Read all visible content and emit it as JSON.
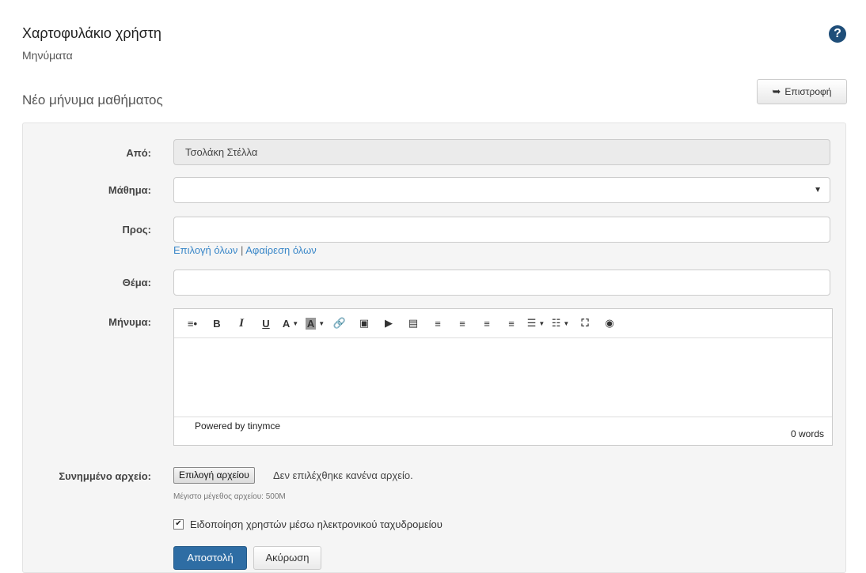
{
  "header": {
    "title": "Χαρτοφυλάκιο χρήστη",
    "subtitle": "Μηνύματα",
    "help_icon": "question-circle-icon"
  },
  "section": {
    "title": "Νέο μήνυμα μαθήματος",
    "back_label": "Επιστροφή",
    "back_icon": "reply-icon"
  },
  "form": {
    "from_label": "Από:",
    "from_value": "Τσολάκη Στέλλα",
    "course_label": "Μάθημα:",
    "course_value": "",
    "to_label": "Προς:",
    "to_value": "",
    "select_all": "Επιλογή όλων",
    "separator": "|",
    "remove_all": "Αφαίρεση όλων",
    "subject_label": "Θέμα:",
    "subject_value": "",
    "message_label": "Μήνυμα:",
    "editor": {
      "toolbar": [
        {
          "name": "format-icon",
          "glyph": "≡•"
        },
        {
          "name": "bold-icon",
          "glyph": "B"
        },
        {
          "name": "italic-icon",
          "glyph": "I"
        },
        {
          "name": "underline-icon",
          "glyph": "U"
        },
        {
          "name": "text-color-icon",
          "glyph": "A"
        },
        {
          "name": "background-color-icon",
          "glyph": "A"
        },
        {
          "name": "link-icon",
          "glyph": "🔗"
        },
        {
          "name": "image-icon",
          "glyph": "▣"
        },
        {
          "name": "media-icon",
          "glyph": "▶"
        },
        {
          "name": "template-icon",
          "glyph": "▤"
        },
        {
          "name": "align-left-icon",
          "glyph": "≡"
        },
        {
          "name": "align-center-icon",
          "glyph": "≡"
        },
        {
          "name": "align-right-icon",
          "glyph": "≡"
        },
        {
          "name": "align-justify-icon",
          "glyph": "≡"
        },
        {
          "name": "bullet-list-icon",
          "glyph": "☰"
        },
        {
          "name": "numbered-list-icon",
          "glyph": "☷"
        },
        {
          "name": "fullscreen-icon",
          "glyph": "⛶"
        },
        {
          "name": "preview-icon",
          "glyph": "◉"
        }
      ],
      "powered_by": "Powered by tinymce",
      "word_count": "0 words"
    },
    "attachment_label": "Συνημμένο αρχείο:",
    "file_button": "Επιλογή αρχείου",
    "file_status": "Δεν επιλέχθηκε κανένα αρχείο.",
    "max_size": "Μέγιστο μέγεθος αρχείου: 500M",
    "notify_label": "Ειδοποίηση χρηστών μέσω ηλεκτρονικού ταχυδρομείου",
    "notify_checked": true,
    "submit_label": "Αποστολή",
    "cancel_label": "Ακύρωση"
  },
  "colors": {
    "primary": "#2e6da4",
    "link": "#3a87c8",
    "help": "#1f4e79",
    "panel": "#f5f5f5"
  }
}
